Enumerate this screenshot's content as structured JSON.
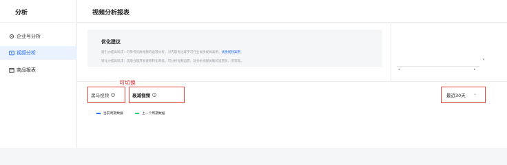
{
  "sidebar": {
    "header": "分析",
    "items": [
      {
        "label": "企业号分析",
        "icon": "gear-icon"
      },
      {
        "label": "视频分析",
        "icon": "video-icon"
      },
      {
        "label": "商品报表",
        "icon": "calendar-icon"
      }
    ]
  },
  "topbar": {
    "title": "视频分析报表"
  },
  "suggestions": {
    "title": "优化建议",
    "line1_text": "吸引力提高玩法：可参考优质视频的运营分析，对内容优化等学习行业优质视频案例。",
    "line1_link": "优质视频案例",
    "line2_text": "转化力提高玩法：选取合理开发者移转化率低，可分析视频运营、及分析视频关联的运营员、货等等。"
  },
  "annotation": "可切换",
  "tabs": {
    "tab1": "黑马视频",
    "tab2": "衰减视频",
    "help": "?"
  },
  "date_select": {
    "value": "最近30天"
  },
  "legend": [
    {
      "label": "当前周期数据",
      "color": "#1f6bff"
    },
    {
      "label": "上一个周期数据",
      "color": "#2ecc71"
    }
  ],
  "colors": {
    "accent": "#1f6bff",
    "highlight_border": "#e8413d"
  }
}
